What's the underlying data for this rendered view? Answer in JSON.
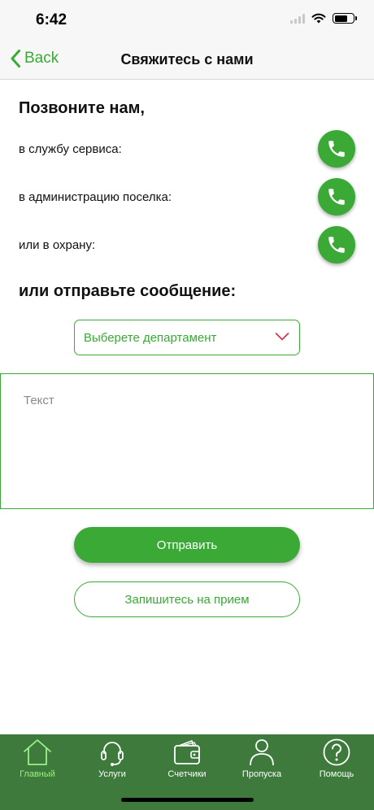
{
  "status_bar": {
    "time": "6:42"
  },
  "nav": {
    "back_label": "Back",
    "title": "Свяжитесь с нами"
  },
  "call_section": {
    "heading": "Позвоните нам,",
    "rows": [
      {
        "label": "в службу сервиса:",
        "icon": "phone-icon"
      },
      {
        "label": "в администрацию поселка:",
        "icon": "phone-icon"
      },
      {
        "label": "или в охрану:",
        "icon": "phone-icon"
      }
    ]
  },
  "message_section": {
    "heading": "или отправьте сообщение:",
    "department_placeholder": "Выберете департамент",
    "text_placeholder": "Текст",
    "send_label": "Отправить",
    "appointment_label": "Запишитесь на прием"
  },
  "tab_bar": {
    "items": [
      {
        "label": "Главный",
        "icon": "home-icon",
        "active": true
      },
      {
        "label": "Услуги",
        "icon": "headset-icon",
        "active": false
      },
      {
        "label": "Счетчики",
        "icon": "wallet-icon",
        "active": false
      },
      {
        "label": "Пропуска",
        "icon": "person-icon",
        "active": false
      },
      {
        "label": "Помощь",
        "icon": "help-icon",
        "active": false
      }
    ]
  },
  "colors": {
    "accent": "#3aa935",
    "tab_bar": "#3d7a3c",
    "tab_active": "#9cf08a",
    "chevron": "#d0304a"
  }
}
